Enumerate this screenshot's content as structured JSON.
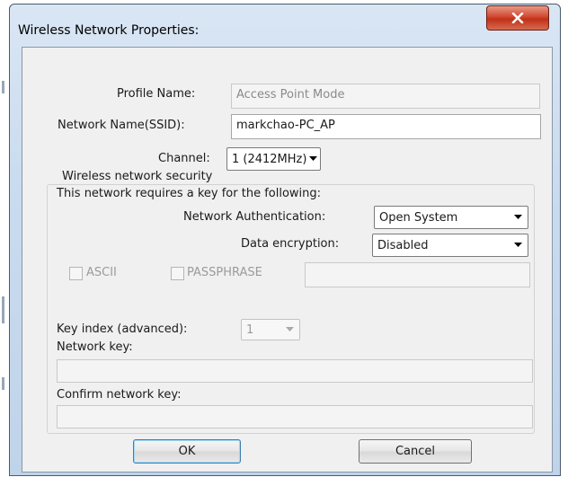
{
  "window": {
    "title": "Wireless Network Properties:"
  },
  "profile": {
    "label": "Profile Name:",
    "value": "Access Point Mode"
  },
  "ssid": {
    "label": "Network Name(SSID):",
    "value": "markchao-PC_AP"
  },
  "channel": {
    "label": "Channel:",
    "value": "1  (2412MHz)"
  },
  "security": {
    "legend": "Wireless network security",
    "description": "This network requires a key for the following:",
    "auth_label": "Network Authentication:",
    "auth_value": "Open System",
    "encryption_label": "Data encryption:",
    "encryption_value": "Disabled",
    "ascii_label": "ASCII",
    "passphrase_label": "PASSPHRASE",
    "key_index_label": "Key index (advanced):",
    "key_index_value": "1",
    "network_key_label": "Network key:",
    "confirm_key_label": "Confirm network key:"
  },
  "buttons": {
    "ok": "OK",
    "cancel": "Cancel"
  },
  "icons": {
    "close": "close-icon",
    "dropdown": "chevron-down-icon"
  }
}
